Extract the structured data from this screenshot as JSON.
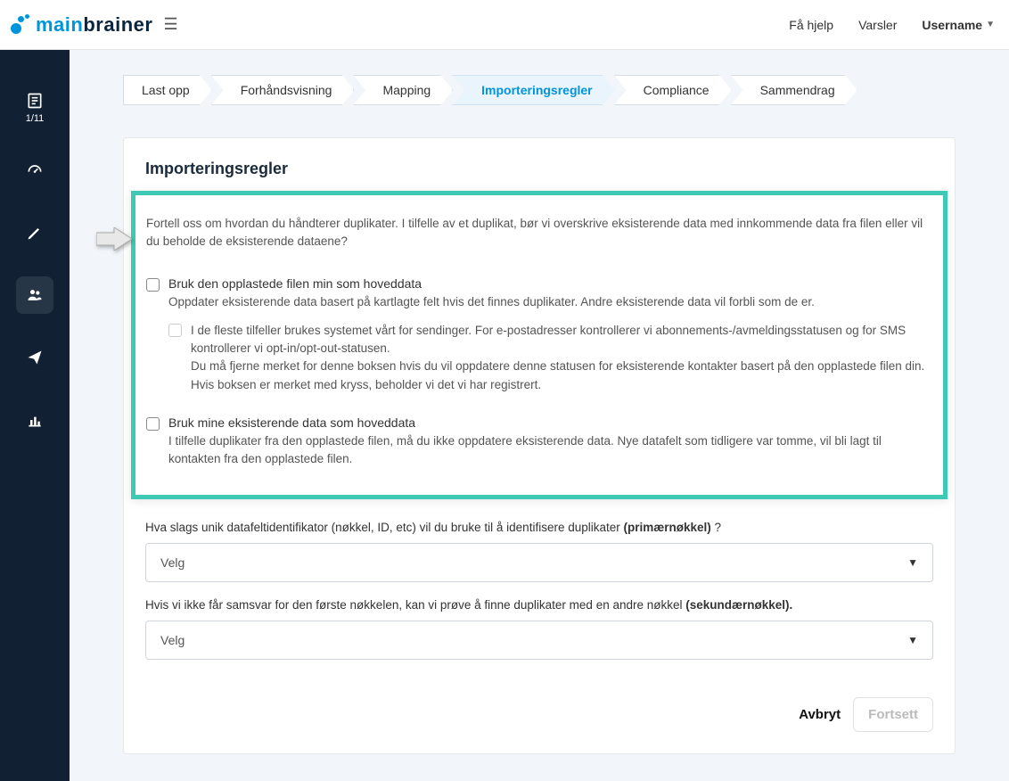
{
  "header": {
    "logo_main": "main",
    "logo_brain": "brainer",
    "help": "Få hjelp",
    "alerts": "Varsler",
    "username": "Username"
  },
  "sidebar": {
    "counter": "1/11"
  },
  "wizard": {
    "steps": [
      {
        "label": "Last opp",
        "active": false
      },
      {
        "label": "Forhåndsvisning",
        "active": false
      },
      {
        "label": "Mapping",
        "active": false
      },
      {
        "label": "Importeringsregler",
        "active": true
      },
      {
        "label": "Compliance",
        "active": false
      },
      {
        "label": "Sammendrag",
        "active": false
      }
    ]
  },
  "card": {
    "title": "Importeringsregler",
    "intro": "Fortell oss om hvordan du håndterer duplikater. I tilfelle av et duplikat, bør vi overskrive eksisterende data med innkommende data fra filen eller vil du beholde de eksisterende dataene?",
    "opt1_label": "Bruk den opplastede filen min som hoveddata",
    "opt1_desc": "Oppdater eksisterende data basert på kartlagte felt hvis det finnes duplikater. Andre eksisterende data vil forbli som de er.",
    "opt1_sub_p1": "I de fleste tilfeller brukes systemet vårt for sendinger. For e-postadresser kontrollerer vi abonnements-/avmeldingsstatusen og for SMS kontrollerer vi opt-in/opt-out-statusen.",
    "opt1_sub_p2": "Du må fjerne merket for denne boksen hvis du vil oppdatere denne statusen for eksisterende kontakter basert på den opplastede filen din. Hvis boksen er merket med kryss, beholder vi det vi har registrert.",
    "opt2_label": "Bruk mine eksisterende data som hoveddata",
    "opt2_desc": "I tilfelle duplikater fra den opplastede filen, må du ikke oppdatere eksisterende data. Nye datafelt som tidligere var tomme, vil bli lagt til kontakten fra den opplastede filen.",
    "primary_q_pre": "Hva slags unik datafeltidentifikator (nøkkel, ID, etc) vil du bruke til å identifisere duplikater ",
    "primary_q_bold": "(primærnøkkel)",
    "primary_q_post": " ?",
    "secondary_q_pre": "Hvis vi ikke får samsvar for den første nøkkelen, kan vi prøve å finne duplikater med en andre nøkkel ",
    "secondary_q_bold": "(sekundærnøkkel).",
    "select_placeholder": "Velg",
    "cancel": "Avbryt",
    "continue": "Fortsett"
  }
}
